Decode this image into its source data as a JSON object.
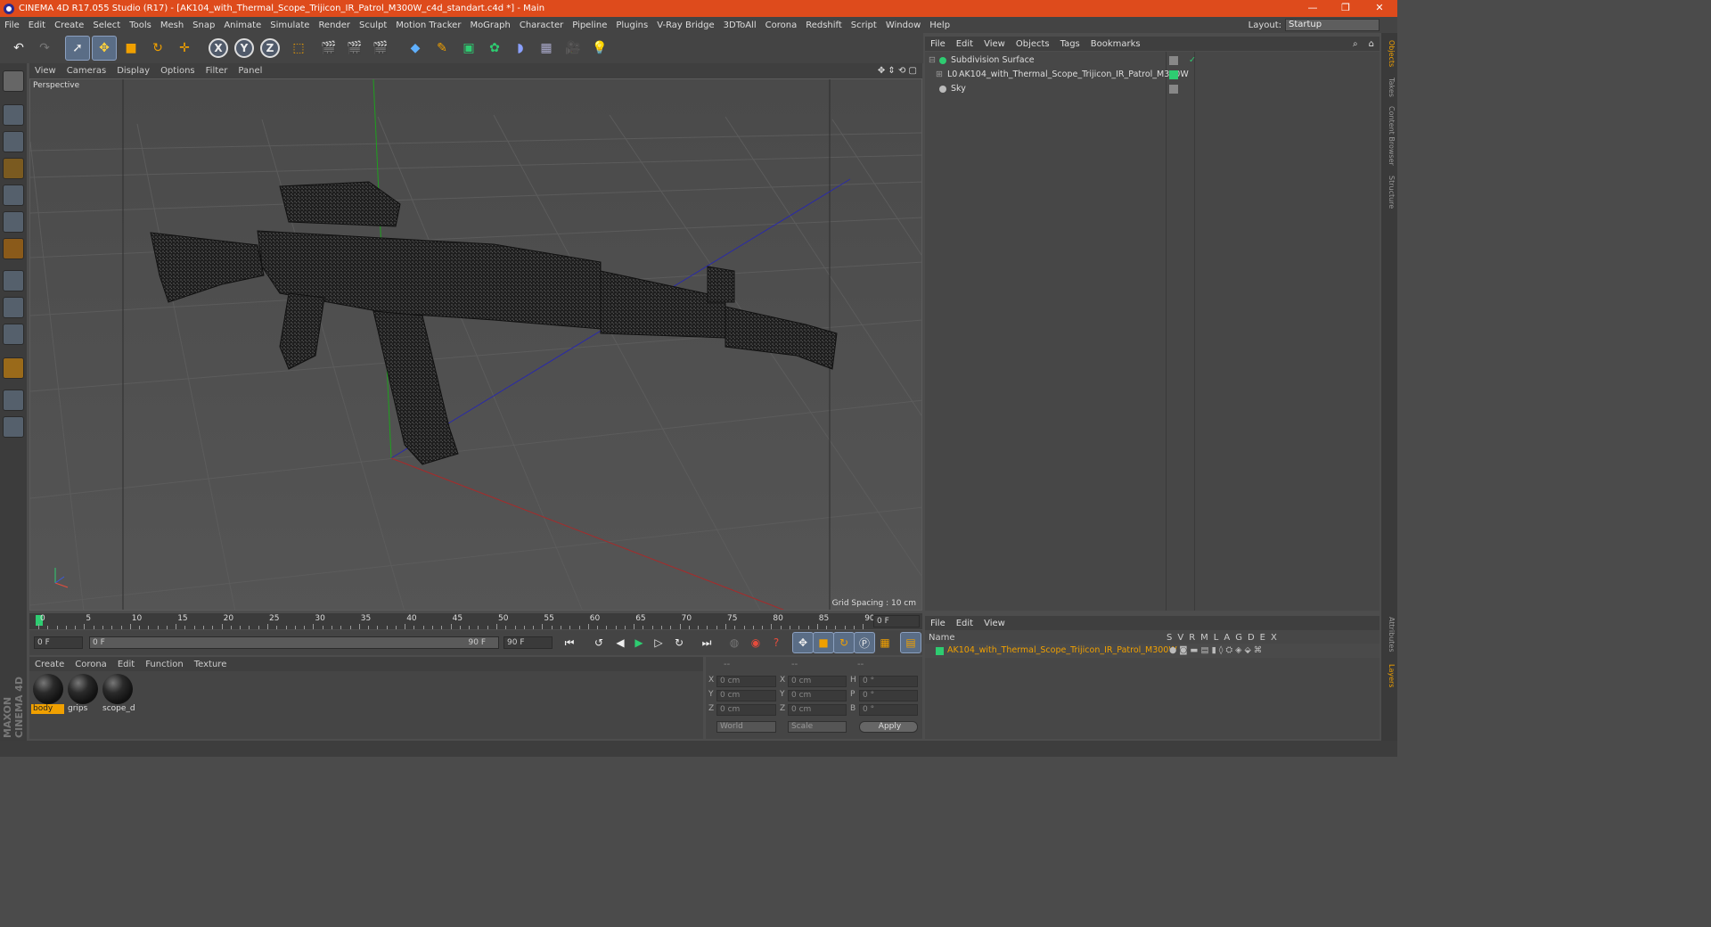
{
  "window": {
    "title": "CINEMA 4D R17.055 Studio (R17) - [AK104_with_Thermal_Scope_Trijicon_IR_Patrol_M300W_c4d_standart.c4d *] - Main",
    "minimize": "—",
    "restore": "❐",
    "close": "✕"
  },
  "menu": [
    "File",
    "Edit",
    "Create",
    "Select",
    "Tools",
    "Mesh",
    "Snap",
    "Animate",
    "Simulate",
    "Render",
    "Sculpt",
    "Motion Tracker",
    "MoGraph",
    "Character",
    "Pipeline",
    "Plugins",
    "V-Ray Bridge",
    "3DToAll",
    "Corona",
    "Redshift",
    "Script",
    "Window",
    "Help"
  ],
  "layout": {
    "label": "Layout:",
    "value": "Startup"
  },
  "toolbar": {
    "x": "X",
    "y": "Y",
    "z": "Z"
  },
  "viewport": {
    "menu": [
      "View",
      "Cameras",
      "Display",
      "Options",
      "Filter",
      "Panel"
    ],
    "label": "Perspective",
    "grid_spacing": "Grid Spacing : 10 cm"
  },
  "timeline": {
    "ticks": [
      "0",
      "5",
      "10",
      "15",
      "20",
      "25",
      "30",
      "35",
      "40",
      "45",
      "50",
      "55",
      "60",
      "65",
      "70",
      "75",
      "80",
      "85",
      "90"
    ],
    "current_frame": "0 F",
    "start": "0 F",
    "range_start": "0 F",
    "range_end": "90 F",
    "end": "90 F"
  },
  "materials": {
    "menu": [
      "Create",
      "Corona",
      "Edit",
      "Function",
      "Texture"
    ],
    "items": [
      "body",
      "grips",
      "scope_d"
    ]
  },
  "coordinates": {
    "headers": [
      "--",
      "--",
      "--"
    ],
    "rows": [
      {
        "a": "X",
        "av": "0 cm",
        "b": "X",
        "bv": "0 cm",
        "c": "H",
        "cv": "0 °"
      },
      {
        "a": "Y",
        "av": "0 cm",
        "b": "Y",
        "bv": "0 cm",
        "c": "P",
        "cv": "0 °"
      },
      {
        "a": "Z",
        "av": "0 cm",
        "b": "Z",
        "bv": "0 cm",
        "c": "B",
        "cv": "0 °"
      }
    ],
    "mode": "World",
    "scale": "Scale",
    "apply": "Apply"
  },
  "objects": {
    "menu": [
      "File",
      "Edit",
      "View",
      "Objects",
      "Tags",
      "Bookmarks"
    ],
    "items": [
      {
        "name": "Subdivision Surface",
        "color": "#2ecc71"
      },
      {
        "name": "AK104_with_Thermal_Scope_Trijicon_IR_Patrol_M300W",
        "color": "#2ecc71"
      },
      {
        "name": "Sky",
        "color": "#888888"
      }
    ]
  },
  "layers": {
    "menu": [
      "File",
      "Edit",
      "View"
    ],
    "name_header": "Name",
    "columns": [
      "S",
      "V",
      "R",
      "M",
      "L",
      "A",
      "G",
      "D",
      "E",
      "X"
    ],
    "item": "AK104_with_Thermal_Scope_Trijicon_IR_Patrol_M300W",
    "item_color": "#f0a000"
  },
  "side_tabs": [
    "Objects",
    "Takes",
    "Content Browser",
    "Structure"
  ],
  "side_tabs_bottom": [
    "Attributes",
    "Layers"
  ],
  "brand": "MAXON CINEMA 4D"
}
